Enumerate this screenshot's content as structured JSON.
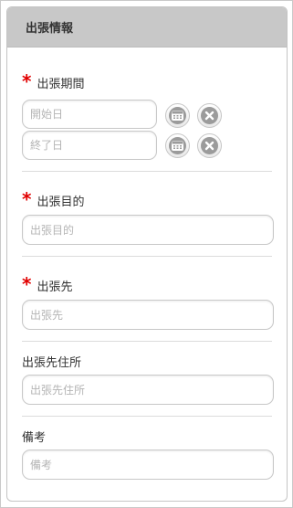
{
  "header": {
    "title": "出張情報"
  },
  "fields": {
    "period": {
      "label": "出張期間",
      "start_placeholder": "開始日",
      "end_placeholder": "終了日"
    },
    "purpose": {
      "label": "出張目的",
      "placeholder": "出張目的"
    },
    "destination": {
      "label": "出張先",
      "placeholder": "出張先"
    },
    "address": {
      "label": "出張先住所",
      "placeholder": "出張先住所"
    },
    "notes": {
      "label": "備考",
      "placeholder": "備考"
    }
  },
  "required_mark": "*",
  "icons": {
    "calendar": "calendar-icon",
    "clear": "clear-icon"
  },
  "colors": {
    "header_bg": "#c8c8c8",
    "required": "#e10000",
    "icon": "#9b9b9b"
  }
}
